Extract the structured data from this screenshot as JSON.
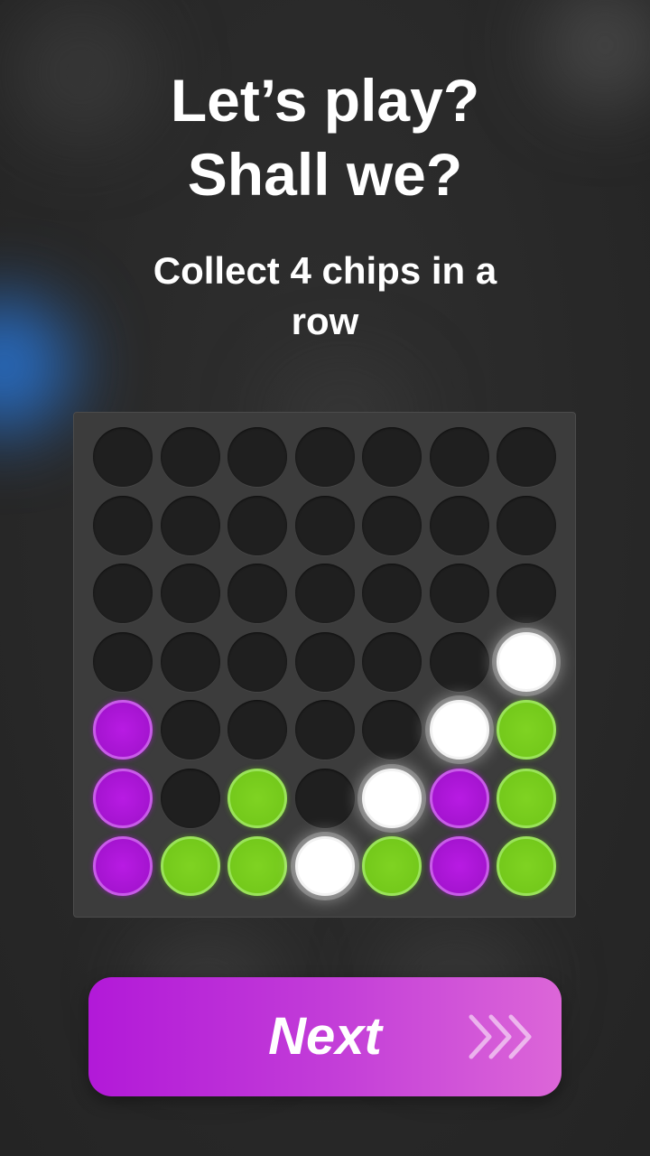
{
  "header": {
    "title_line1": "Let’s play?",
    "title_line2": "Shall we?",
    "subtitle": "Collect 4 chips in a row"
  },
  "board": {
    "columns": 7,
    "rows": 7,
    "grid": [
      [
        "empty",
        "empty",
        "empty",
        "empty",
        "empty",
        "empty",
        "empty"
      ],
      [
        "empty",
        "empty",
        "empty",
        "empty",
        "empty",
        "empty",
        "empty"
      ],
      [
        "empty",
        "empty",
        "empty",
        "empty",
        "empty",
        "empty",
        "empty"
      ],
      [
        "empty",
        "empty",
        "empty",
        "empty",
        "empty",
        "empty",
        "white"
      ],
      [
        "purple",
        "empty",
        "empty",
        "empty",
        "empty",
        "white",
        "green"
      ],
      [
        "purple",
        "empty",
        "green",
        "empty",
        "white",
        "purple",
        "green"
      ],
      [
        "purple",
        "green",
        "green",
        "white",
        "green",
        "purple",
        "green"
      ]
    ],
    "colors": {
      "purple": "#b01ad8",
      "green": "#78cc1e",
      "white": "#ffffff",
      "empty": "#1f1f1f"
    }
  },
  "next_button": {
    "label": "Next",
    "icon": "triple-chevron-right-icon"
  }
}
